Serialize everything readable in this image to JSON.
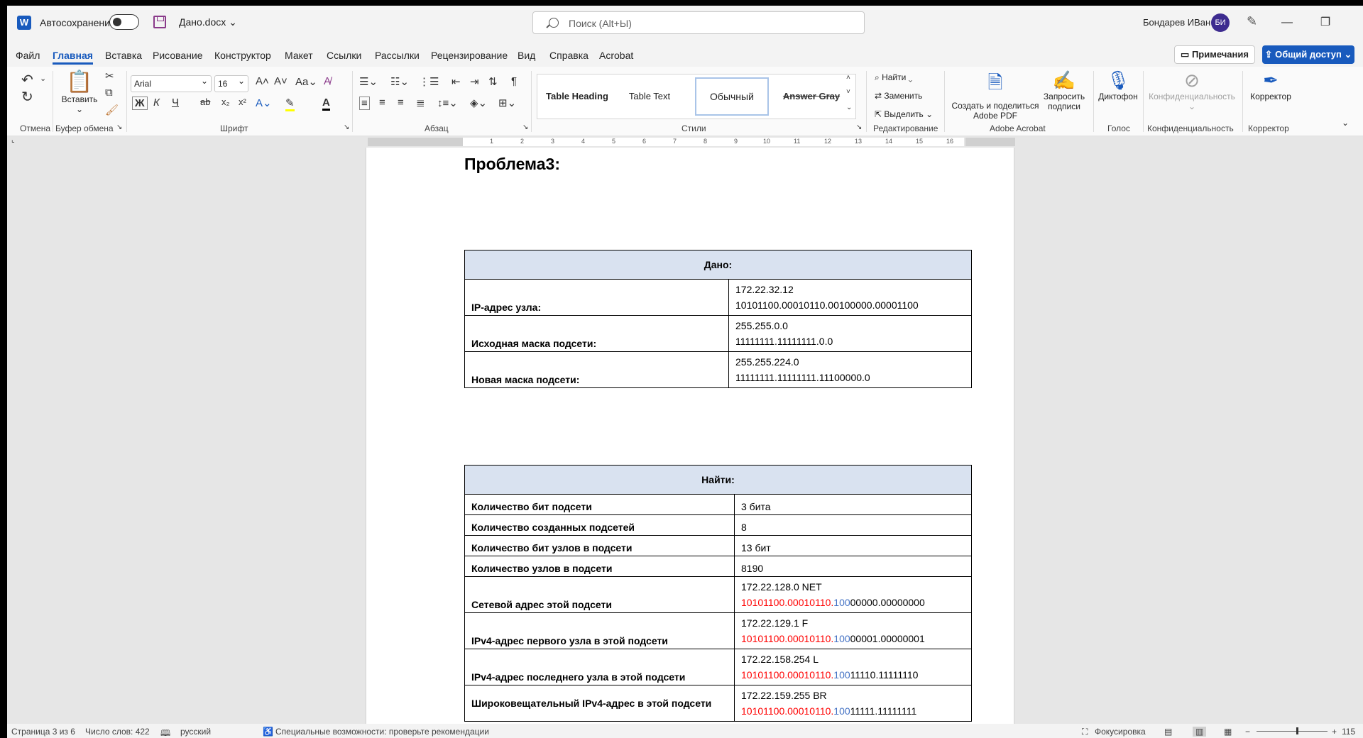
{
  "titlebar": {
    "autosave_label": "Автосохранение",
    "doc_name": "Дано.docx",
    "search_placeholder": "Поиск (Alt+Ы)",
    "user_name": "Бондарев ИВан",
    "avatar_initials": "БИ"
  },
  "menu": {
    "tabs": [
      "Файл",
      "Главная",
      "Вставка",
      "Рисование",
      "Конструктор",
      "Макет",
      "Ссылки",
      "Рассылки",
      "Рецензирование",
      "Вид",
      "Справка",
      "Acrobat"
    ],
    "active_tab": "Главная",
    "comments": "Примечания",
    "share": "Общий доступ"
  },
  "ribbon": {
    "groups": {
      "undo": "Отмена",
      "clipboard": "Буфер обмена",
      "font": "Шрифт",
      "paragraph": "Абзац",
      "styles": "Стили",
      "editing": "Редактирование",
      "acrobat": "Adobe Acrobat",
      "voice": "Голос",
      "sensitivity": "Конфиденциальность",
      "editor": "Корректор"
    },
    "paste": "Вставить",
    "font_name": "Arial",
    "font_size": "16",
    "bold": "Ж",
    "italic": "К",
    "underline": "Ч",
    "strike": "ab",
    "styles": [
      "Table Heading",
      "Table Text",
      "Обычный",
      "Answer Gray"
    ],
    "find": "Найти",
    "replace": "Заменить",
    "select": "Выделить",
    "create_pdf": "Создать и поделиться Adobe PDF",
    "request_sign": "Запросить подписи",
    "dictate": "Диктофон",
    "sensitivity_btn": "Конфиденциальность",
    "editor_btn": "Корректор"
  },
  "ruler": {
    "ticks": [
      "1",
      "2",
      "3",
      "4",
      "5",
      "6",
      "7",
      "8",
      "9",
      "10",
      "11",
      "12",
      "13",
      "14",
      "15",
      "16"
    ]
  },
  "document": {
    "heading": "Проблема3:",
    "given": {
      "title": "Дано:",
      "rows": [
        {
          "label": "IP-адрес узла:",
          "line1": "172.22.32.12",
          "line2": "10101100.00010110.00100000.00001100"
        },
        {
          "label": "Исходная маска подсети:",
          "line1": "255.255.0.0",
          "line2": "11111111.11111111.0.0"
        },
        {
          "label": "Новая маска подсети:",
          "line1": "255.255.224.0",
          "line2": "11111111.11111111.11100000.0"
        }
      ]
    },
    "find": {
      "title": "Найти:",
      "short_rows": [
        {
          "label": "Количество бит подсети",
          "value": "3 бита"
        },
        {
          "label": "Количество созданных подсетей",
          "value": "8"
        },
        {
          "label": "Количество бит узлов в подсети",
          "value": "13 бит"
        },
        {
          "label": "Количество узлов в подсети",
          "value": "8190"
        }
      ],
      "tall_rows": [
        {
          "label": "Сетевой адрес этой подсети",
          "line1": "172.22.128.0 NET",
          "red": "10101100.00010110.",
          "blue": "100",
          "rest": "00000.00000000"
        },
        {
          "label": "IPv4-адрес первого узла в этой подсети",
          "line1": "172.22.129.1 F",
          "red": "10101100.00010110.",
          "blue": "100",
          "rest": "00001.00000001"
        },
        {
          "label": "IPv4-адрес последнего узла в этой подсети",
          "line1": "172.22.158.254 L",
          "red": "10101100.00010110.",
          "blue": "100",
          "rest": "11110.11111110"
        },
        {
          "label": "Широковещательный IPv4-адрес в этой подсети",
          "line1": "172.22.159.255 BR",
          "red": "10101100.00010110.",
          "blue": "100",
          "rest": "11111.11111111"
        }
      ]
    }
  },
  "status": {
    "page": "Страница 3 из 6",
    "words": "Число слов: 422",
    "language": "русский",
    "accessibility": "Специальные возможности: проверьте рекомендации",
    "focus": "Фокусировка",
    "zoom": "115 %"
  },
  "colors": {
    "accent": "#185abd",
    "table_header": "#d9e2f0",
    "red_bits": "#ff0000",
    "blue_bits": "#4472c4"
  }
}
